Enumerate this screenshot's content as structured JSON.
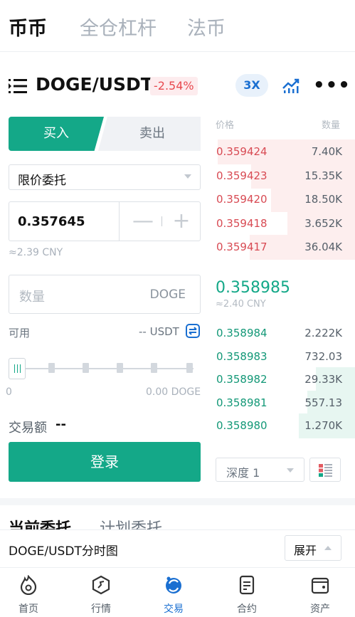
{
  "top_tabs": [
    "币币",
    "全仓杠杆",
    "法币"
  ],
  "pair": {
    "name": "DOGE/USDT",
    "change": "-2.54%",
    "leverage": "3X",
    "more": "•••"
  },
  "trade_tabs": {
    "buy": "买入",
    "sell": "卖出"
  },
  "order_type": {
    "selected": "限价委托"
  },
  "price_input": {
    "value": "0.357645",
    "minus": "—",
    "plus": "+",
    "cny": "≈2.39 CNY"
  },
  "quantity_input": {
    "placeholder": "数量",
    "unit": "DOGE"
  },
  "available": {
    "label": "可用",
    "value": "-- USDT"
  },
  "slider": {
    "min_label": "0",
    "max_label": "0.00 DOGE",
    "level_percent": 0
  },
  "turnover": {
    "label": "交易额",
    "value": "--"
  },
  "login_button": "登录",
  "order_book": {
    "price_header": "价格",
    "qty_header": "数量",
    "asks": [
      {
        "price": "0.359424",
        "qty": "7.40K",
        "depth": 0.98
      },
      {
        "price": "0.359423",
        "qty": "15.35K",
        "depth": 0.74
      },
      {
        "price": "0.359420",
        "qty": "18.50K",
        "depth": 0.6
      },
      {
        "price": "0.359418",
        "qty": "3.652K",
        "depth": 0.48
      },
      {
        "price": "0.359417",
        "qty": "36.04K",
        "depth": 0.75
      }
    ],
    "last_price": "0.358985",
    "last_price_cny": "≈2.40 CNY",
    "bids": [
      {
        "price": "0.358984",
        "qty": "2.222K",
        "depth": 0.0
      },
      {
        "price": "0.358983",
        "qty": "732.03",
        "depth": 0.0
      },
      {
        "price": "0.358982",
        "qty": "29.33K",
        "depth": 0.28
      },
      {
        "price": "0.358981",
        "qty": "557.13",
        "depth": 0.34
      },
      {
        "price": "0.358980",
        "qty": "1.270K",
        "depth": 0.4
      }
    ],
    "depth_select": "深度 1"
  },
  "orders_tabs": [
    "当前委托",
    "计划委托"
  ],
  "chart_bar": {
    "title": "DOGE/USDT分时图",
    "expand": "展开"
  },
  "bottom_nav": [
    {
      "label": "首页",
      "icon": "flame-icon"
    },
    {
      "label": "行情",
      "icon": "market-icon"
    },
    {
      "label": "交易",
      "icon": "trade-icon",
      "active": true
    },
    {
      "label": "合约",
      "icon": "contract-icon"
    },
    {
      "label": "资产",
      "icon": "wallet-icon"
    }
  ],
  "colors": {
    "green": "#14a888",
    "red": "#d84a53",
    "blue": "#1a6fd1"
  }
}
